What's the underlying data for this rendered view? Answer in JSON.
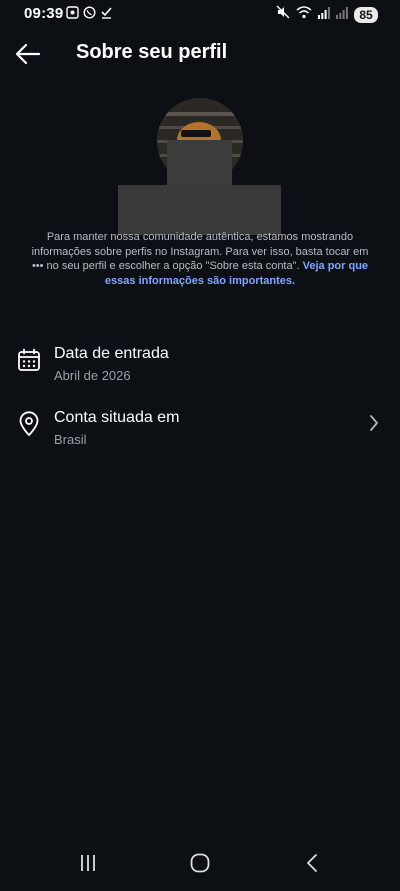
{
  "status_bar": {
    "time": "09:39",
    "battery": "85",
    "left_icons": [
      "screenshot-icon",
      "whatsapp-icon",
      "download-check-icon"
    ],
    "right_icons": [
      "mute-icon",
      "wifi-icon",
      "signal-icon",
      "signal-icon"
    ]
  },
  "header": {
    "title": "Sobre seu perfil",
    "back_icon": "arrow-left-icon"
  },
  "info": {
    "text": "Para manter nossa comunidade autêntica, estamos mostrando informações sobre perfis no Instagram. Para ver isso, basta tocar em ••• no seu perfil e escolher a opção \"Sobre esta conta\". ",
    "link": "Veja por que essas informações são importantes."
  },
  "rows": [
    {
      "icon": "calendar-icon",
      "title": "Data de entrada",
      "subtitle": "Abril de 2026"
    },
    {
      "icon": "location-pin-icon",
      "title": "Conta situada em",
      "subtitle": "Brasil",
      "chevron": "chevron-right-icon"
    }
  ],
  "nav": {
    "icons": [
      "recents-icon",
      "home-icon",
      "back-icon"
    ]
  },
  "colors": {
    "background": "#0c0f14",
    "text_primary": "#ffffff",
    "text_secondary": "#9aa0a8",
    "link": "#7ea8ff"
  }
}
